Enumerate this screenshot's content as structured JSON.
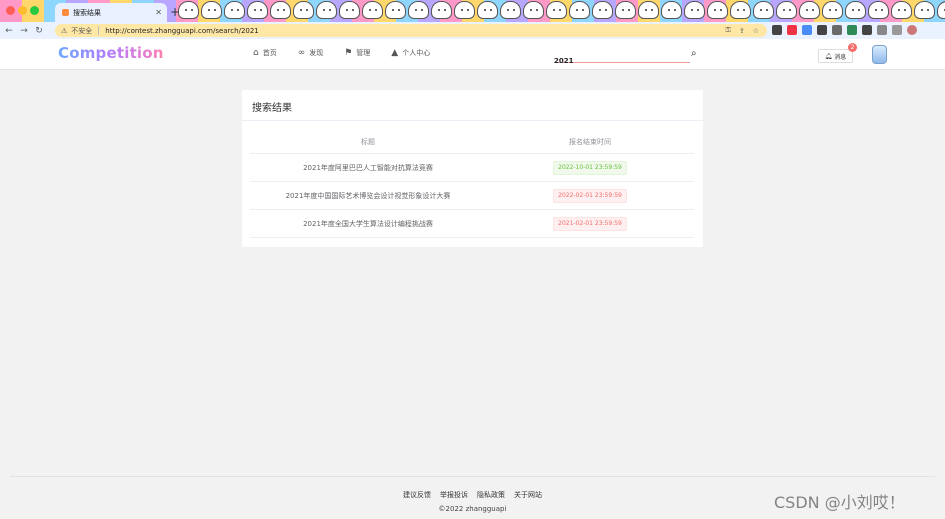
{
  "browser": {
    "tab_title": "搜索结果",
    "insecure_label": "不安全",
    "url": "http://contest.zhangguapi.com/search/2021"
  },
  "header": {
    "logo": "Competition",
    "nav": [
      {
        "label": "首页",
        "icon": "home-icon"
      },
      {
        "label": "发现",
        "icon": "infinity-icon"
      },
      {
        "label": "管理",
        "icon": "flag-icon"
      },
      {
        "label": "个人中心",
        "icon": "graduation-cap-icon"
      }
    ],
    "search_value": "2021",
    "message_label": "消息",
    "message_badge": "2"
  },
  "results": {
    "title": "搜索结果",
    "columns": [
      "标题",
      "报名结束时间"
    ],
    "rows": [
      {
        "title": "2021年度阿里巴巴人工智能对抗算法竞赛",
        "deadline": "2022-10-01 23:59:59",
        "status": "green"
      },
      {
        "title": "2021年度中国国际艺术博览会设计视觉形象设计大赛",
        "deadline": "2022-02-01 23:59:59",
        "status": "red"
      },
      {
        "title": "2021年度全国大学生算法设计编程挑战赛",
        "deadline": "2021-02-01 23:59:59",
        "status": "red"
      }
    ]
  },
  "footer": {
    "links": [
      "建议反馈",
      "举报投诉",
      "隐私政策",
      "关于网站"
    ],
    "copyright": "©2022 zhangguapi"
  },
  "watermark": "CSDN @小刘哎！",
  "colors": {
    "accent_red": "#f56c6c",
    "accent_green": "#67c23a"
  }
}
